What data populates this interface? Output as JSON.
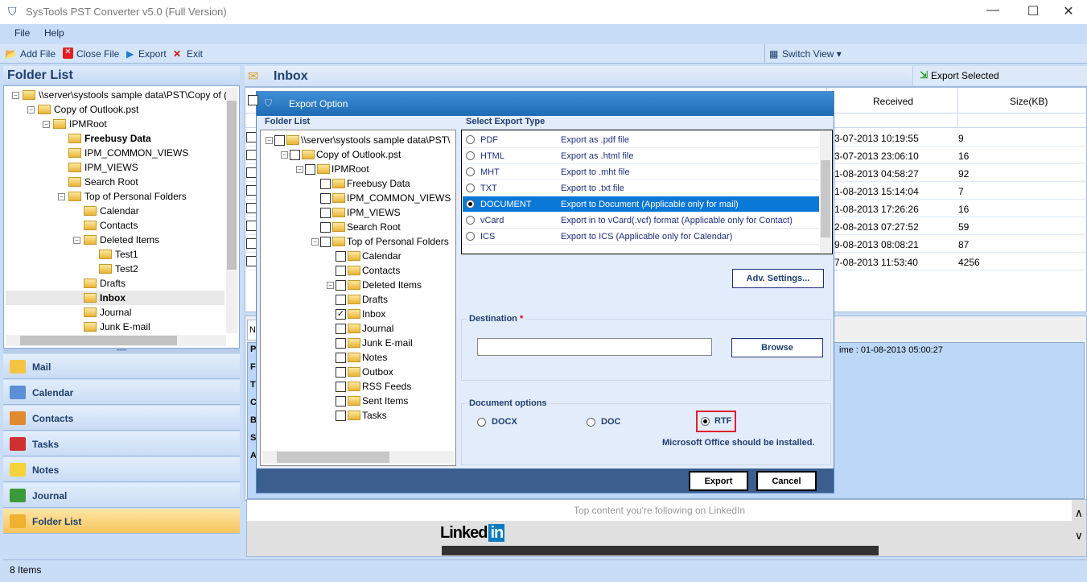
{
  "window": {
    "title": "SysTools  PST Converter v5.0 (Full Version)",
    "min": "—",
    "max": "☐",
    "close": "✕"
  },
  "menu": [
    "File",
    "Help"
  ],
  "toolbar": {
    "add_file": "Add File",
    "close_file": "Close File",
    "export": "Export",
    "exit": "Exit",
    "switch_view": "Switch View ▾"
  },
  "left": {
    "header": "Folder List",
    "tree": [
      {
        "label": "\\\\server\\systools sample data\\PST\\Copy of (",
        "bold": false
      },
      {
        "label": "Copy of Outlook.pst"
      },
      {
        "label": "IPMRoot"
      },
      {
        "label": "Freebusy Data",
        "bold": true
      },
      {
        "label": "IPM_COMMON_VIEWS"
      },
      {
        "label": "IPM_VIEWS"
      },
      {
        "label": "Search Root"
      },
      {
        "label": "Top of Personal Folders"
      },
      {
        "label": "Calendar"
      },
      {
        "label": "Contacts"
      },
      {
        "label": "Deleted Items"
      },
      {
        "label": "Test1"
      },
      {
        "label": "Test2"
      },
      {
        "label": "Drafts"
      },
      {
        "label": "Inbox",
        "bold": true,
        "selected": true
      },
      {
        "label": "Journal"
      },
      {
        "label": "Junk E-mail"
      }
    ],
    "nav": [
      "Mail",
      "Calendar",
      "Contacts",
      "Tasks",
      "Notes",
      "Journal",
      "Folder List"
    ],
    "nav_active": "Folder List"
  },
  "status": "8 Items",
  "inbox": {
    "title": "Inbox",
    "export_selected": "Export Selected",
    "columns": {
      "received": "Received",
      "size": "Size(KB)"
    },
    "rows": [
      {
        "received": "3-07-2013 10:19:55",
        "size": "9"
      },
      {
        "received": "3-07-2013 23:06:10",
        "size": "16"
      },
      {
        "received": "1-08-2013 04:58:27",
        "size": "92"
      },
      {
        "received": "1-08-2013 15:14:04",
        "size": "7"
      },
      {
        "received": "1-08-2013 17:26:26",
        "size": "16"
      },
      {
        "received": "2-08-2013 07:27:52",
        "size": "59"
      },
      {
        "received": "9-08-2013 08:08:21",
        "size": "87"
      },
      {
        "received": "7-08-2013 11:53:40",
        "size": "4256"
      }
    ],
    "preview_letters": [
      "P",
      "F",
      "T",
      "C",
      "B",
      "S",
      "A"
    ],
    "preview_tab": "N",
    "preview_time": "ime  :  01-08-2013 05:00:27",
    "linkedin_caption": "Top content you're following on LinkedIn",
    "linkedin_logo": "Linked",
    "linkedin_in": "in"
  },
  "dialog": {
    "title": "Export Option",
    "folder_list_label": "Folder List",
    "tree": [
      {
        "label": "\\\\server\\systools sample data\\PST\\"
      },
      {
        "label": "Copy of Outlook.pst"
      },
      {
        "label": "IPMRoot"
      },
      {
        "label": "Freebusy Data"
      },
      {
        "label": "IPM_COMMON_VIEWS"
      },
      {
        "label": "IPM_VIEWS"
      },
      {
        "label": "Search Root"
      },
      {
        "label": "Top of Personal Folders"
      },
      {
        "label": "Calendar"
      },
      {
        "label": "Contacts"
      },
      {
        "label": "Deleted Items"
      },
      {
        "label": "Drafts"
      },
      {
        "label": "Inbox",
        "checked": true
      },
      {
        "label": "Journal"
      },
      {
        "label": "Junk E-mail"
      },
      {
        "label": "Notes"
      },
      {
        "label": "Outbox"
      },
      {
        "label": "RSS Feeds"
      },
      {
        "label": "Sent Items"
      },
      {
        "label": "Tasks"
      }
    ],
    "export_type_label": "Select Export Type",
    "types": [
      {
        "name": "PDF",
        "desc": "Export as .pdf file"
      },
      {
        "name": "HTML",
        "desc": "Export as .html file"
      },
      {
        "name": "MHT",
        "desc": "Export to .mht file"
      },
      {
        "name": "TXT",
        "desc": "Export to .txt file"
      },
      {
        "name": "DOCUMENT",
        "desc": "Export to Document (Applicable only for mail)",
        "selected": true
      },
      {
        "name": "vCard",
        "desc": "Export in to vCard(.vcf) format (Applicable only for Contact)"
      },
      {
        "name": "ICS",
        "desc": "Export to ICS (Applicable only for Calendar)"
      }
    ],
    "adv_settings": "Adv. Settings...",
    "destination_label": "Destination",
    "required": "*",
    "destination_value": "",
    "browse": "Browse",
    "doc_options_label": "Document options",
    "doc_options": [
      "DOCX",
      "DOC",
      "RTF"
    ],
    "doc_selected": "RTF",
    "note": "Microsoft Office should be installed.",
    "export": "Export",
    "cancel": "Cancel"
  }
}
